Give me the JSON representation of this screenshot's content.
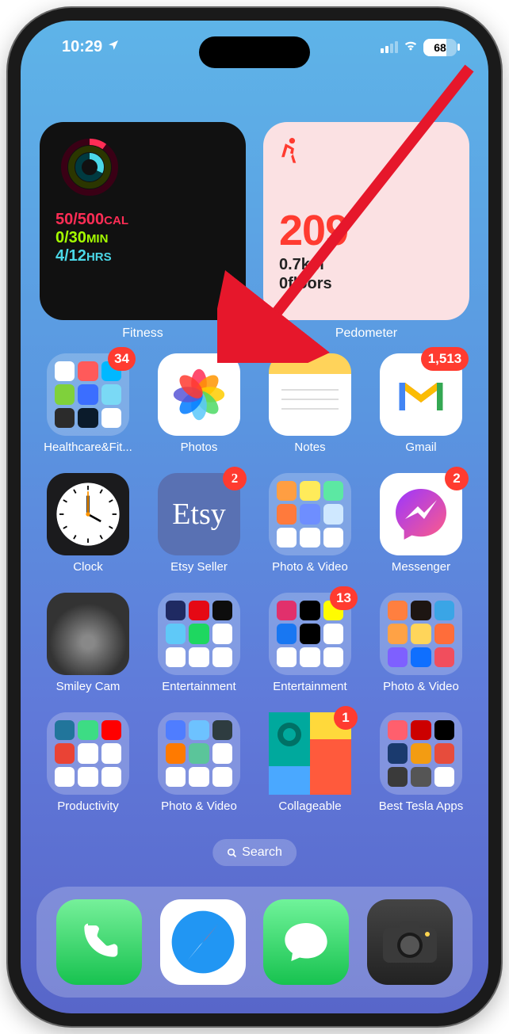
{
  "status": {
    "time": "10:29",
    "battery": "68",
    "location_icon": "location-arrow"
  },
  "widgets": {
    "fitness": {
      "label": "Fitness",
      "move": "50/500",
      "move_unit": "CAL",
      "exercise": "0/30",
      "exercise_unit": "MIN",
      "stand": "4/12",
      "stand_unit": "HRS"
    },
    "pedometer": {
      "label": "Pedometer",
      "steps": "209",
      "floors_line1": "0.7km",
      "floors_line2": "0floors"
    }
  },
  "rows": [
    [
      {
        "label": "Healthcare&Fit...",
        "type": "folder",
        "badge": "34",
        "minis": [
          "#ffffff",
          "#ff5a5a",
          "#00b8ff",
          "#7fd13b",
          "#3b6eff",
          "#7ad9f5",
          "#2b2b2b",
          "#0b1b2b",
          "#fff"
        ]
      },
      {
        "label": "Photos",
        "type": "photos"
      },
      {
        "label": "Notes",
        "type": "notes"
      },
      {
        "label": "Gmail",
        "type": "gmail",
        "badge": "1,513"
      }
    ],
    [
      {
        "label": "Clock",
        "type": "clock"
      },
      {
        "label": "Etsy Seller",
        "type": "etsy",
        "badge": "2",
        "text": "Etsy"
      },
      {
        "label": "Photo & Video",
        "type": "folder",
        "minis": [
          "#ff9e42",
          "#ffeb5a",
          "#5ce8a3",
          "#ff7a3c",
          "#6e8eff",
          "#cfe8ff",
          "#fff",
          "#fff",
          "#fff"
        ]
      },
      {
        "label": "Messenger",
        "type": "messenger",
        "badge": "2"
      }
    ],
    [
      {
        "label": "Smiley Cam",
        "type": "smiley"
      },
      {
        "label": "Entertainment",
        "type": "folder",
        "minis": [
          "#1f2a62",
          "#e50914",
          "#0d0d0d",
          "#5fc9f8",
          "#1ed760",
          "#fff",
          "#fff",
          "#fff",
          "#fff"
        ]
      },
      {
        "label": "Entertainment",
        "type": "folder",
        "badge": "13",
        "minis": [
          "#e1306c",
          "#000",
          "#fffc00",
          "#1877f2",
          "#000",
          "#fff",
          "#fff",
          "#fff",
          "#fff"
        ]
      },
      {
        "label": "Photo & Video",
        "type": "folder",
        "minis": [
          "#ff7f3f",
          "#1d1512",
          "#3aa5e6",
          "#ffa245",
          "#ffd55a",
          "#ff6d3a",
          "#7e60ff",
          "#0f6fff",
          "#f14e5d"
        ]
      }
    ],
    [
      {
        "label": "Productivity",
        "type": "folder",
        "minis": [
          "#21759b",
          "#3ddc84",
          "#ff0000",
          "#ea4335",
          "#fff",
          "#fff",
          "#fff",
          "#fff",
          "#fff"
        ]
      },
      {
        "label": "Photo & Video",
        "type": "folder",
        "minis": [
          "#4f7dff",
          "#6dc2ff",
          "#2e3c40",
          "#ff7a00",
          "#5bc59a",
          "#fff",
          "#fff",
          "#fff",
          "#fff"
        ]
      },
      {
        "label": "Collageable",
        "type": "collageable",
        "badge": "1"
      },
      {
        "label": "Best Tesla Apps",
        "type": "folder",
        "minis": [
          "#ff5f6d",
          "#cc0000",
          "#000",
          "#1a3a6e",
          "#f39c12",
          "#e74c3c",
          "#3a3a3a",
          "#555",
          "#fff"
        ]
      }
    ]
  ],
  "search": {
    "label": "Search"
  },
  "dock": [
    {
      "name": "Phone",
      "type": "phone"
    },
    {
      "name": "Safari",
      "type": "safari"
    },
    {
      "name": "Messages",
      "type": "messages"
    },
    {
      "name": "Camera",
      "type": "camera"
    }
  ],
  "annotation": {
    "arrow": "points from top-right toward Notes app"
  }
}
